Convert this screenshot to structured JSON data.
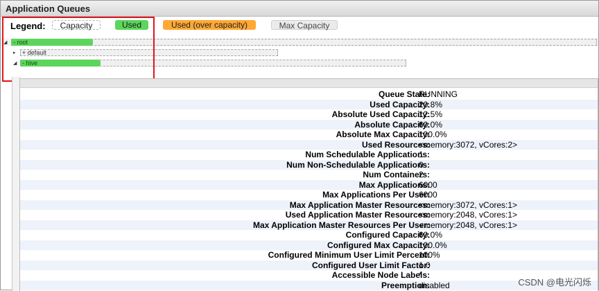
{
  "title": "Application Queues",
  "legend": {
    "label": "Legend:",
    "items": [
      {
        "label": "Capacity",
        "color": "#ffffff"
      },
      {
        "label": "Used",
        "color": "#5bd55b"
      },
      {
        "label": "Used (over capacity)",
        "color": "#ffa834"
      },
      {
        "label": "Max Capacity",
        "color": "#ebebeb"
      }
    ]
  },
  "queues": [
    {
      "name": "root",
      "prefix": "-",
      "expanded": true,
      "used_percent": 12.5,
      "max_percent": 100
    },
    {
      "name": "default",
      "prefix": "+",
      "expanded": false,
      "used_percent": 0,
      "max_percent": 100
    },
    {
      "name": "hive",
      "prefix": "-",
      "expanded": true,
      "used_percent": 20.8,
      "max_percent": 100
    }
  ],
  "queue_info": [
    {
      "key": "Queue State:",
      "value": "RUNNING"
    },
    {
      "key": "Used Capacity:",
      "value": "20.8%"
    },
    {
      "key": "Absolute Used Capacity:",
      "value": "12.5%"
    },
    {
      "key": "Absolute Capacity:",
      "value": "60.0%"
    },
    {
      "key": "Absolute Max Capacity:",
      "value": "100.0%"
    },
    {
      "key": "Used Resources:",
      "value": "<memory:3072, vCores:2>"
    },
    {
      "key": "Num Schedulable Applications:",
      "value": "1"
    },
    {
      "key": "Num Non-Schedulable Applications:",
      "value": "0"
    },
    {
      "key": "Num Containers:",
      "value": "2"
    },
    {
      "key": "Max Applications:",
      "value": "6000"
    },
    {
      "key": "Max Applications Per User:",
      "value": "6000"
    },
    {
      "key": "Max Application Master Resources:",
      "value": "<memory:3072, vCores:1>"
    },
    {
      "key": "Used Application Master Resources:",
      "value": "<memory:2048, vCores:1>"
    },
    {
      "key": "Max Application Master Resources Per User:",
      "value": "<memory:2048, vCores:1>"
    },
    {
      "key": "Configured Capacity:",
      "value": "60.0%"
    },
    {
      "key": "Configured Max Capacity:",
      "value": "100.0%"
    },
    {
      "key": "Configured Minimum User Limit Percent:",
      "value": "100%"
    },
    {
      "key": "Configured User Limit Factor:",
      "value": "1.0"
    },
    {
      "key": "Accessible Node Labels:",
      "value": "*"
    },
    {
      "key": "Preemption:",
      "value": "disabled"
    }
  ],
  "watermark": "CSDN @电光闪烁",
  "colors": {
    "used": "#5bd55b",
    "over": "#ffa834",
    "highlight_box": "#e0141e"
  }
}
